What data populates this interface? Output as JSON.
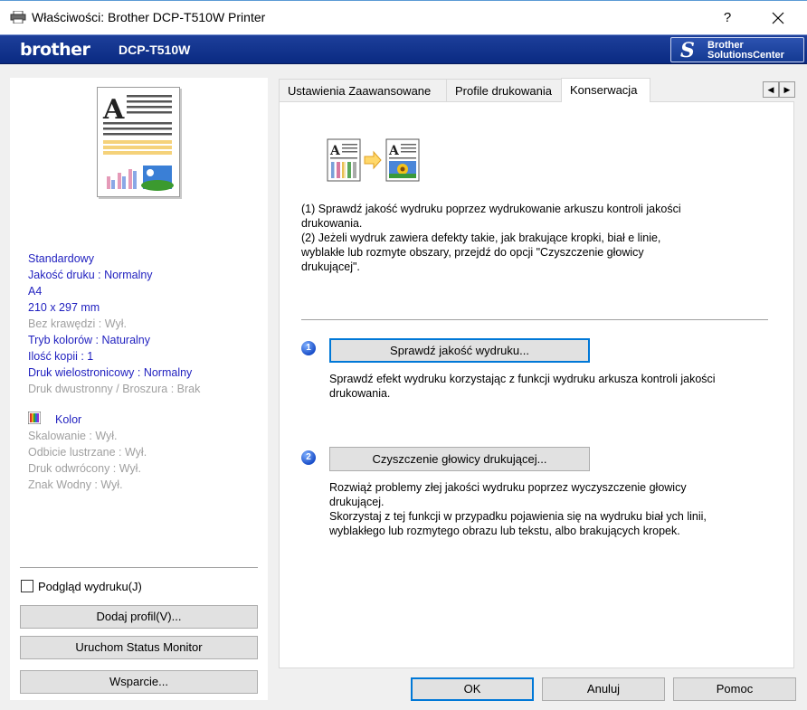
{
  "window": {
    "title": "Właściwości: Brother DCP-T510W Printer",
    "help_label": "?"
  },
  "banner": {
    "logo": "brother",
    "model": "DCP-T510W",
    "solutions_mark": "S",
    "solutions_label": "Brother\nSolutionsCenter"
  },
  "summary": {
    "items_active": [
      "Standardowy",
      "Jakość druku : Normalny",
      "A4",
      "210 x 297 mm"
    ],
    "borderless": "Bez krawędzi : Wył.",
    "color_mode": "Tryb kolorów : Naturalny",
    "copies": "Ilość kopii  : 1",
    "multipage": "Druk wielostronicowy  : Normalny",
    "duplex": "Druk dwustronny / Broszura : Brak",
    "kolor": "Kolor",
    "items_disabled": [
      "Skalowanie : Wył.",
      "Odbicie lustrzane  : Wył.",
      "Druk odwrócony  : Wył.",
      "Znak Wodny : Wył."
    ]
  },
  "left_controls": {
    "preview_label": "Podgląd wydruku(J)",
    "preview_checked": false,
    "add_profile": "Dodaj profil(V)...",
    "status_monitor": "Uruchom Status Monitor",
    "support": "Wsparcie..."
  },
  "tabs": [
    {
      "label": "Ustawienia Zaawansowane",
      "active": false
    },
    {
      "label": "Profile drukowania",
      "active": false
    },
    {
      "label": "Konserwacja",
      "active": true
    }
  ],
  "maintenance": {
    "intro": "(1) Sprawdź jakość wydruku poprzez wydrukowanie arkuszu kontroli jakości\ndrukowania.\n(2) Jeżeli wydruk zawiera defekty takie, jak brakujące kropki, biał e linie,\nwyblakłe lub rozmyte obszary, przejdź do opcji \"Czyszczenie głowicy\ndrukującej\".",
    "step1_number": "1",
    "step1_button": "Sprawdź jakość wydruku...",
    "step1_desc": "Sprawdź efekt wydruku korzystając z funkcji wydruku arkusza kontroli jakości\ndrukowania.",
    "step2_number": "2",
    "step2_button": "Czyszczenie głowicy drukującej...",
    "step2_desc": "Rozwiąż problemy złej jakości wydruku poprzez wyczyszczenie głowicy\ndrukującej.\nSkorzystaj z tej funkcji w przypadku pojawienia się na wydruku biał ych linii,\nwyblakłego lub rozmytego obrazu lub tekstu, albo brakujących kropek."
  },
  "footer": {
    "ok": "OK",
    "cancel": "Anuluj",
    "help": "Pomoc"
  }
}
